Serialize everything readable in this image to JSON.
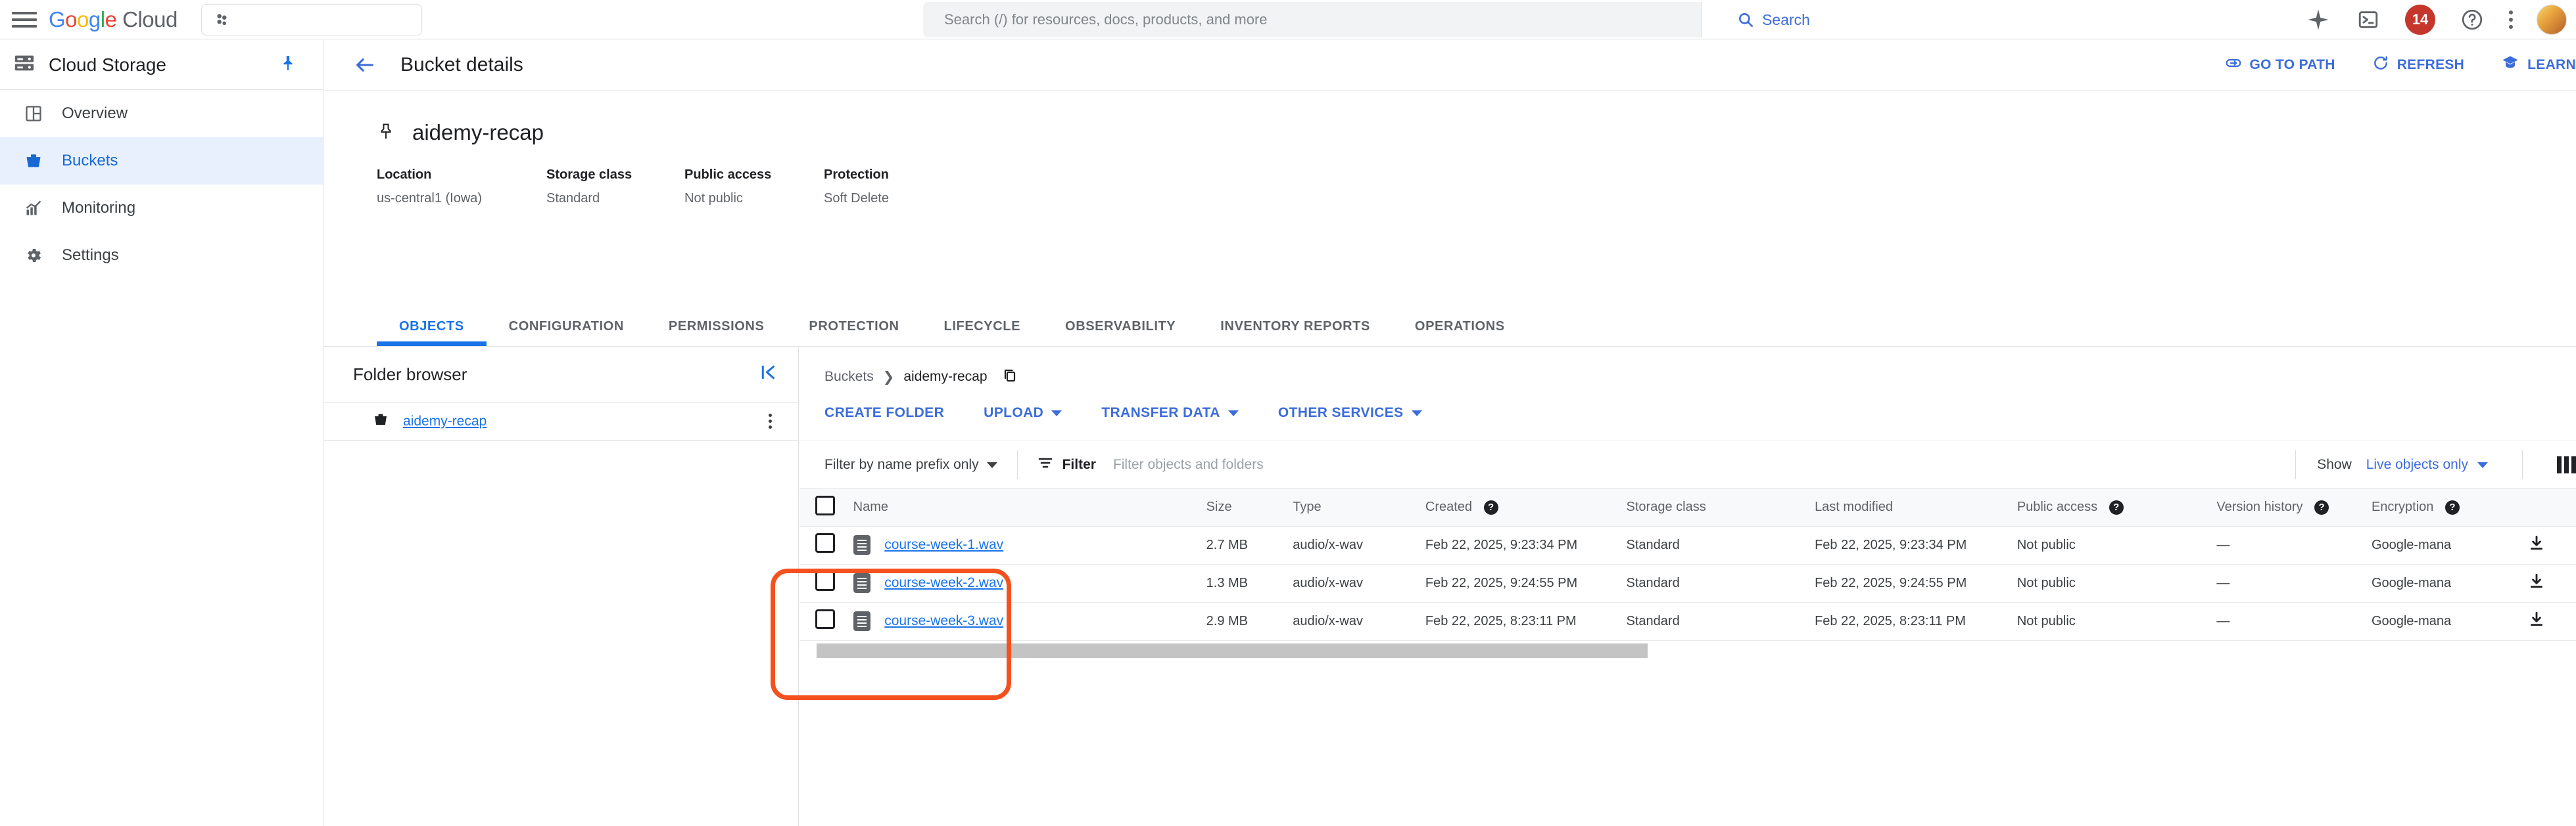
{
  "topbar": {
    "menu_icon": "hamburger-icon",
    "logo": {
      "g": "G",
      "o1": "o",
      "o2": "o",
      "g2": "g",
      "l": "l",
      "e": "e",
      "cloud": "Cloud"
    },
    "project_picker_placeholder": "",
    "search": {
      "placeholder": "Search (/) for resources, docs, products, and more",
      "value": "",
      "button_label": "Search"
    },
    "icons": [
      "gemini-sparkle-icon",
      "cloud-shell-icon",
      "notifications-icon",
      "help-icon",
      "more-options-icon",
      "avatar"
    ],
    "notification_count": "14"
  },
  "sidebar": {
    "product_title": "Cloud Storage",
    "items": [
      {
        "label": "Overview",
        "icon": "dashboard-icon",
        "active": false
      },
      {
        "label": "Buckets",
        "icon": "bucket-icon",
        "active": true
      },
      {
        "label": "Monitoring",
        "icon": "chart-icon",
        "active": false
      },
      {
        "label": "Settings",
        "icon": "gear-icon",
        "active": false
      }
    ]
  },
  "page": {
    "title": "Bucket details",
    "actions": [
      {
        "label": "GO TO PATH",
        "icon": "link-icon"
      },
      {
        "label": "REFRESH",
        "icon": "refresh-icon"
      },
      {
        "label": "LEARN",
        "icon": "learn-icon"
      }
    ]
  },
  "bucket": {
    "name": "aidemy-recap",
    "meta": [
      {
        "label": "Location",
        "value": "us-central1 (Iowa)"
      },
      {
        "label": "Storage class",
        "value": "Standard"
      },
      {
        "label": "Public access",
        "value": "Not public"
      },
      {
        "label": "Protection",
        "value": "Soft Delete"
      }
    ]
  },
  "tabs": [
    {
      "label": "OBJECTS",
      "active": true
    },
    {
      "label": "CONFIGURATION",
      "active": false
    },
    {
      "label": "PERMISSIONS",
      "active": false
    },
    {
      "label": "PROTECTION",
      "active": false
    },
    {
      "label": "LIFECYCLE",
      "active": false
    },
    {
      "label": "OBSERVABILITY",
      "active": false
    },
    {
      "label": "INVENTORY REPORTS",
      "active": false
    },
    {
      "label": "OPERATIONS",
      "active": false
    }
  ],
  "folder_browser": {
    "title": "Folder browser",
    "collapse_icon": "collapse-panel-icon",
    "root": "aidemy-recap"
  },
  "objects": {
    "breadcrumb": {
      "root": "Buckets",
      "separator": "❯",
      "current": "aidemy-recap"
    },
    "actions": [
      {
        "label": "CREATE FOLDER",
        "has_caret": false
      },
      {
        "label": "UPLOAD",
        "has_caret": true
      },
      {
        "label": "TRANSFER DATA",
        "has_caret": true
      },
      {
        "label": "OTHER SERVICES",
        "has_caret": true
      }
    ],
    "filter": {
      "prefix_mode": "Filter by name prefix only",
      "filter_label": "Filter",
      "placeholder": "Filter objects and folders",
      "value": "",
      "show_label": "Show",
      "show_value": "Live objects only"
    },
    "columns": [
      {
        "label": "Name",
        "help": false
      },
      {
        "label": "Size",
        "help": false
      },
      {
        "label": "Type",
        "help": false
      },
      {
        "label": "Created",
        "help": true
      },
      {
        "label": "Storage class",
        "help": false
      },
      {
        "label": "Last modified",
        "help": false
      },
      {
        "label": "Public access",
        "help": true
      },
      {
        "label": "Version history",
        "help": true
      },
      {
        "label": "Encryption",
        "help": true
      }
    ],
    "rows": [
      {
        "name": "course-week-1.wav",
        "size": "2.7 MB",
        "type": "audio/x-wav",
        "created": "Feb 22, 2025, 9:23:34 PM",
        "storage_class": "Standard",
        "last_modified": "Feb 22, 2025, 9:23:34 PM",
        "public_access": "Not public",
        "version_history": "—",
        "encryption": "Google-mana"
      },
      {
        "name": "course-week-2.wav",
        "size": "1.3 MB",
        "type": "audio/x-wav",
        "created": "Feb 22, 2025, 9:24:55 PM",
        "storage_class": "Standard",
        "last_modified": "Feb 22, 2025, 9:24:55 PM",
        "public_access": "Not public",
        "version_history": "—",
        "encryption": "Google-mana"
      },
      {
        "name": "course-week-3.wav",
        "size": "2.9 MB",
        "type": "audio/x-wav",
        "created": "Feb 22, 2025, 8:23:11 PM",
        "storage_class": "Standard",
        "last_modified": "Feb 22, 2025, 8:23:11 PM",
        "public_access": "Not public",
        "version_history": "—",
        "encryption": "Google-mana"
      }
    ]
  },
  "annotation": {
    "shape": "rounded-rectangle",
    "color": "#f4511e"
  },
  "colors": {
    "accent": "#1a73e8",
    "link": "#3c6ddb",
    "badge": "#c5372c",
    "annotation": "#f4511e"
  }
}
